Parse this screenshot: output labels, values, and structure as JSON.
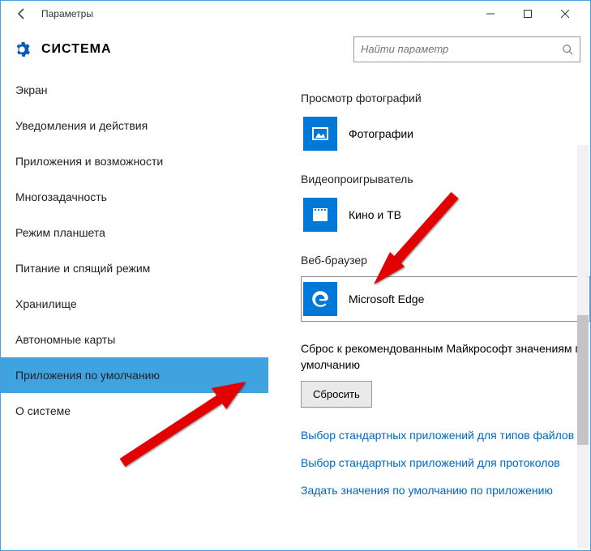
{
  "window": {
    "title": "Параметры"
  },
  "header": {
    "title": "СИСТЕМА",
    "search_placeholder": "Найти параметр"
  },
  "sidebar": {
    "items": [
      "Экран",
      "Уведомления и действия",
      "Приложения и возможности",
      "Многозадачность",
      "Режим планшета",
      "Питание и спящий режим",
      "Хранилище",
      "Автономные карты",
      "Приложения по умолчанию",
      "О системе"
    ],
    "selected_index": 8
  },
  "content": {
    "photo_viewer": {
      "label": "Просмотр фотографий",
      "app": "Фотографии"
    },
    "video_player": {
      "label": "Видеопроигрыватель",
      "app": "Кино и ТВ"
    },
    "web_browser": {
      "label": "Веб-браузер",
      "app": "Microsoft Edge"
    },
    "reset": {
      "text": "Сброс к рекомендованным Майкрософт значениям по умолчанию",
      "button": "Сбросить"
    },
    "links": [
      "Выбор стандартных приложений для типов файлов",
      "Выбор стандартных приложений для протоколов",
      "Задать значения по умолчанию по приложению"
    ]
  }
}
